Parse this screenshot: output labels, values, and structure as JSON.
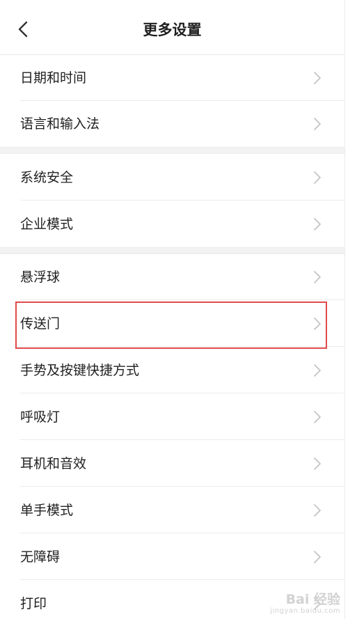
{
  "header": {
    "title": "更多设置",
    "back_icon": "chevron-left-icon"
  },
  "groups": [
    {
      "items": [
        {
          "label": "日期和时间"
        },
        {
          "label": "语言和输入法"
        }
      ]
    },
    {
      "items": [
        {
          "label": "系统安全"
        },
        {
          "label": "企业模式"
        }
      ]
    },
    {
      "items": [
        {
          "label": "悬浮球"
        },
        {
          "label": "传送门",
          "highlighted": true
        },
        {
          "label": "手势及按键快捷方式"
        },
        {
          "label": "呼吸灯"
        },
        {
          "label": "耳机和音效"
        },
        {
          "label": "单手模式"
        },
        {
          "label": "无障碍"
        },
        {
          "label": "打印"
        }
      ]
    }
  ],
  "colors": {
    "highlight_border": "#e04a4a",
    "text": "#1f1f1f",
    "chevron": "#c4c4c4",
    "section_gap": "#f2f2f2"
  },
  "watermark": {
    "main": "Bai 经验",
    "sub": "jingyan.baidu.com"
  }
}
